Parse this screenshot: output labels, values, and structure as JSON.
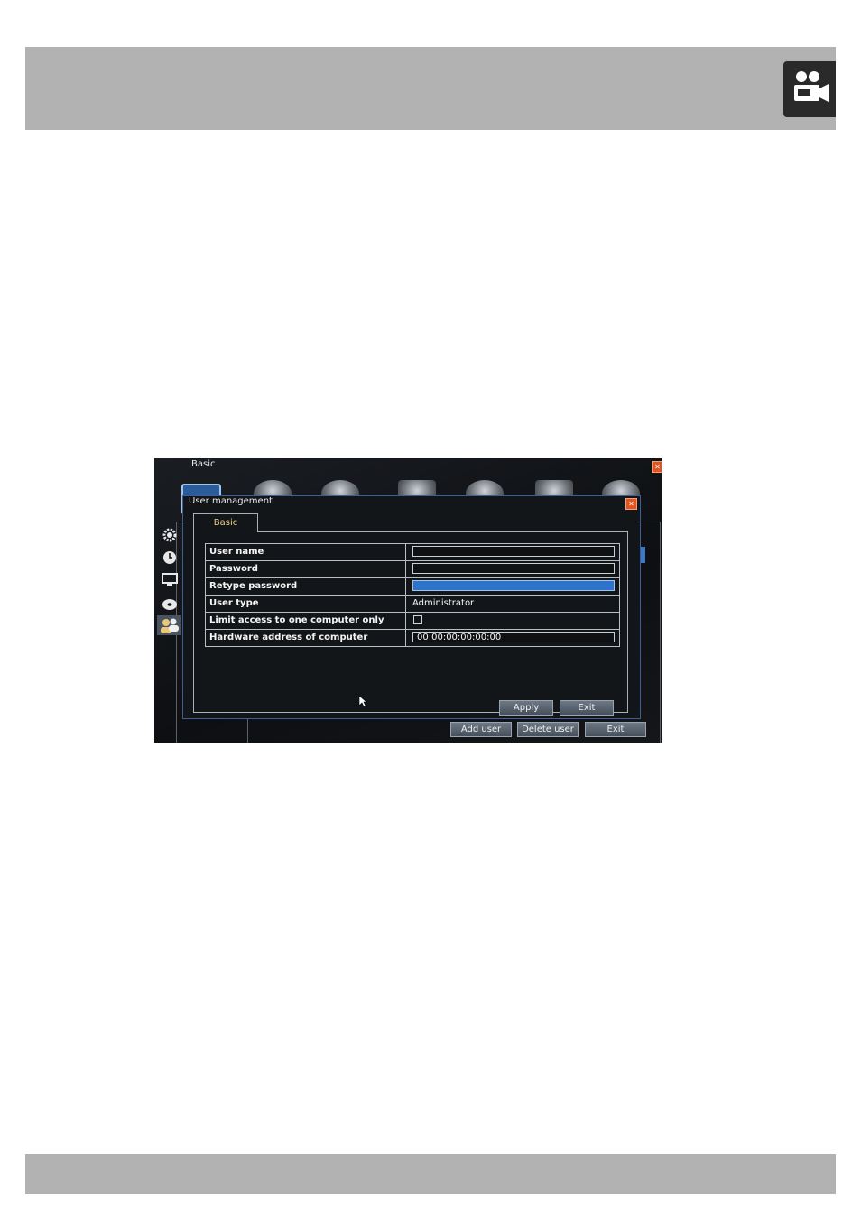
{
  "window": {
    "title": "Basic"
  },
  "dialog": {
    "title": "User management",
    "tab_label": "Basic",
    "fields": {
      "user_name": {
        "label": "User name",
        "value": ""
      },
      "password": {
        "label": "Password",
        "value": ""
      },
      "retype_password": {
        "label": "Retype password",
        "value": ""
      },
      "user_type": {
        "label": "User type",
        "value": "Administrator"
      },
      "limit_access": {
        "label": "Limit access to one computer only",
        "checked": false
      },
      "hardware_address": {
        "label": "Hardware address of computer",
        "value": "00:00:00:00:00:00"
      }
    },
    "apply_label": "Apply",
    "exit_label": "Exit"
  },
  "footer_buttons": {
    "add_user": "Add user",
    "delete_user": "Delete user",
    "exit": "Exit"
  },
  "icons": {
    "header_logo": "video-camera-users-icon",
    "side_nav": [
      "gear-icon",
      "clock-icon",
      "monitor-icon",
      "disc-icon",
      "users-icon"
    ]
  },
  "colors": {
    "accent": "#2d73c9",
    "close": "#e2541f",
    "tab_text": "#f2d08a"
  }
}
